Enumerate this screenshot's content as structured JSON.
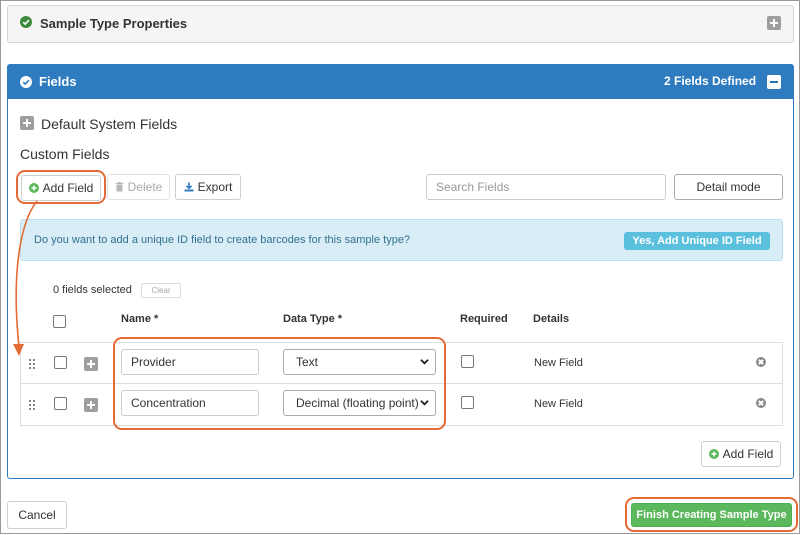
{
  "properties_panel": {
    "title": "Sample Type Properties"
  },
  "fields_panel": {
    "title": "Fields",
    "count_text": "2 Fields Defined",
    "default_system_fields": "Default System Fields",
    "custom_fields": "Custom Fields"
  },
  "toolbar": {
    "add_field": "Add Field",
    "delete": "Delete",
    "export": "Export",
    "search_placeholder": "Search Fields",
    "detail_mode": "Detail mode"
  },
  "alert": {
    "message": "Do you want to add a unique ID field to create barcodes for this sample type?",
    "button": "Yes, Add Unique ID Field"
  },
  "selection": {
    "text": "0 fields selected",
    "clear": "Clear"
  },
  "table": {
    "headers": {
      "name": "Name *",
      "data_type": "Data Type *",
      "required": "Required",
      "details": "Details"
    },
    "rows": [
      {
        "name": "Provider",
        "data_type": "Text",
        "details": "New Field"
      },
      {
        "name": "Concentration",
        "data_type": "Decimal (floating point)",
        "details": "New Field"
      }
    ]
  },
  "bottom_add_field": "Add Field",
  "footer": {
    "cancel": "Cancel",
    "finish": "Finish Creating Sample Type"
  },
  "colors": {
    "primary": "#2e7cbf",
    "success": "#5cb85c",
    "accent": "#e46b35",
    "alert_bg": "#d9edf7",
    "alert_btn": "#5bc0de"
  }
}
